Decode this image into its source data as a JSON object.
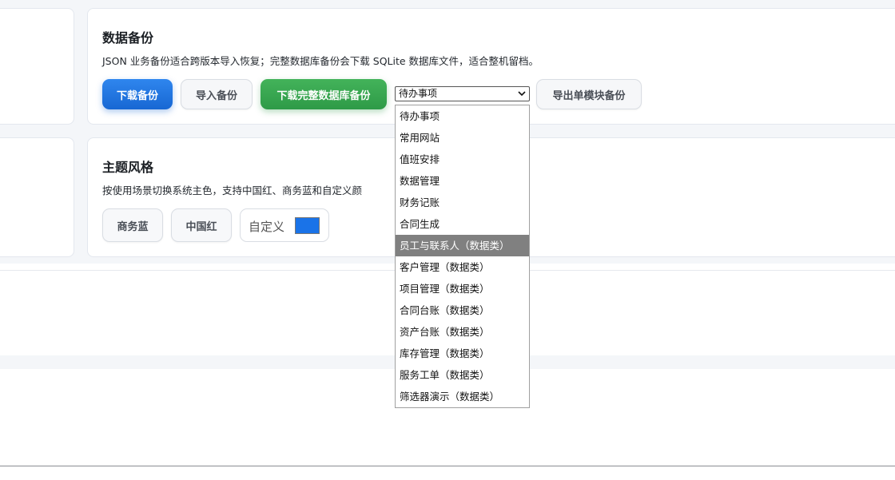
{
  "backup": {
    "title": "数据备份",
    "description": "JSON 业务备份适合跨版本导入恢复；完整数据库备份会下载 SQLite 数据库文件，适合整机留档。",
    "download_label": "下载备份",
    "import_label": "导入备份",
    "download_full_label": "下载完整数据库备份",
    "module_select_value": "待办事项",
    "export_module_label": "导出单模块备份",
    "module_options": [
      "待办事项",
      "常用网站",
      "值班安排",
      "数据管理",
      "财务记账",
      "合同生成",
      "员工与联系人（数据类）",
      "客户管理（数据类）",
      "项目管理（数据类）",
      "合同台账（数据类）",
      "资产台账（数据类）",
      "库存管理（数据类）",
      "服务工单（数据类）",
      "筛选器演示（数据类）"
    ],
    "highlighted_option_index": 6
  },
  "theme": {
    "title": "主题风格",
    "description": "按使用场景切换系统主色，支持中国红、商务蓝和自定义颜",
    "business_blue_label": "商务蓝",
    "china_red_label": "中国红",
    "custom_label": "自定义",
    "custom_color": "#1a73e8"
  },
  "colors": {
    "primary": "#1767d3",
    "success": "#2e9a47",
    "page_bg": "#f4f6f9"
  }
}
